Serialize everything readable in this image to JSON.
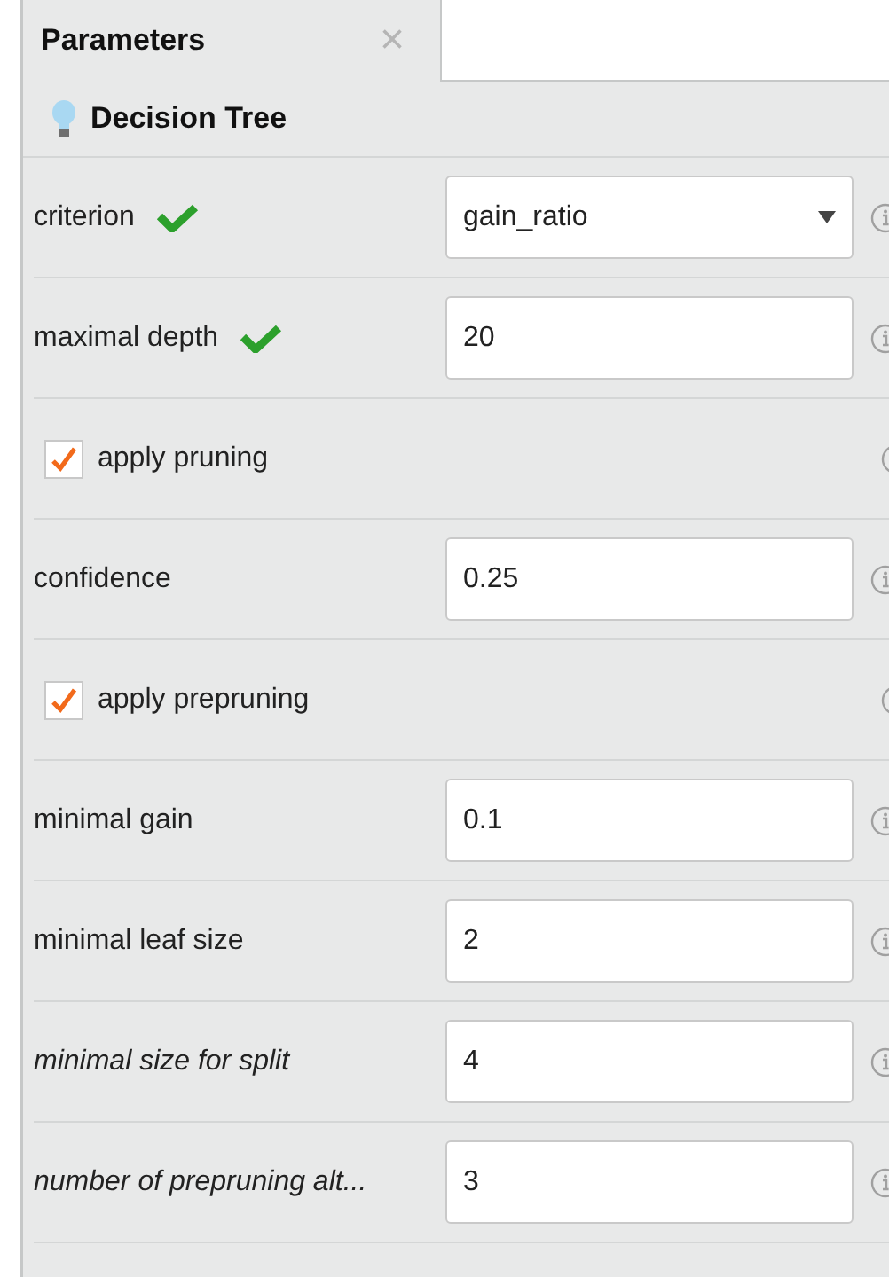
{
  "tab": {
    "title": "Parameters",
    "close": "×"
  },
  "operator": {
    "name": "Decision Tree"
  },
  "parameters": [
    {
      "kind": "select",
      "label": "criterion",
      "value": "gain_ratio",
      "changed": true,
      "expert": false
    },
    {
      "kind": "input",
      "label": "maximal depth",
      "value": "20",
      "changed": true,
      "expert": false
    },
    {
      "kind": "checkbox",
      "label": "apply pruning",
      "checked": true,
      "expert": false
    },
    {
      "kind": "input",
      "label": "confidence",
      "value": "0.25",
      "changed": false,
      "expert": false
    },
    {
      "kind": "checkbox",
      "label": "apply prepruning",
      "checked": true,
      "expert": false
    },
    {
      "kind": "input",
      "label": "minimal gain",
      "value": "0.1",
      "changed": false,
      "expert": false
    },
    {
      "kind": "input",
      "label": "minimal leaf size",
      "value": "2",
      "changed": false,
      "expert": false
    },
    {
      "kind": "input",
      "label": "minimal size for split",
      "value": "4",
      "changed": false,
      "expert": true
    },
    {
      "kind": "input",
      "label": "number of prepruning alt...",
      "value": "3",
      "changed": false,
      "expert": true
    }
  ]
}
